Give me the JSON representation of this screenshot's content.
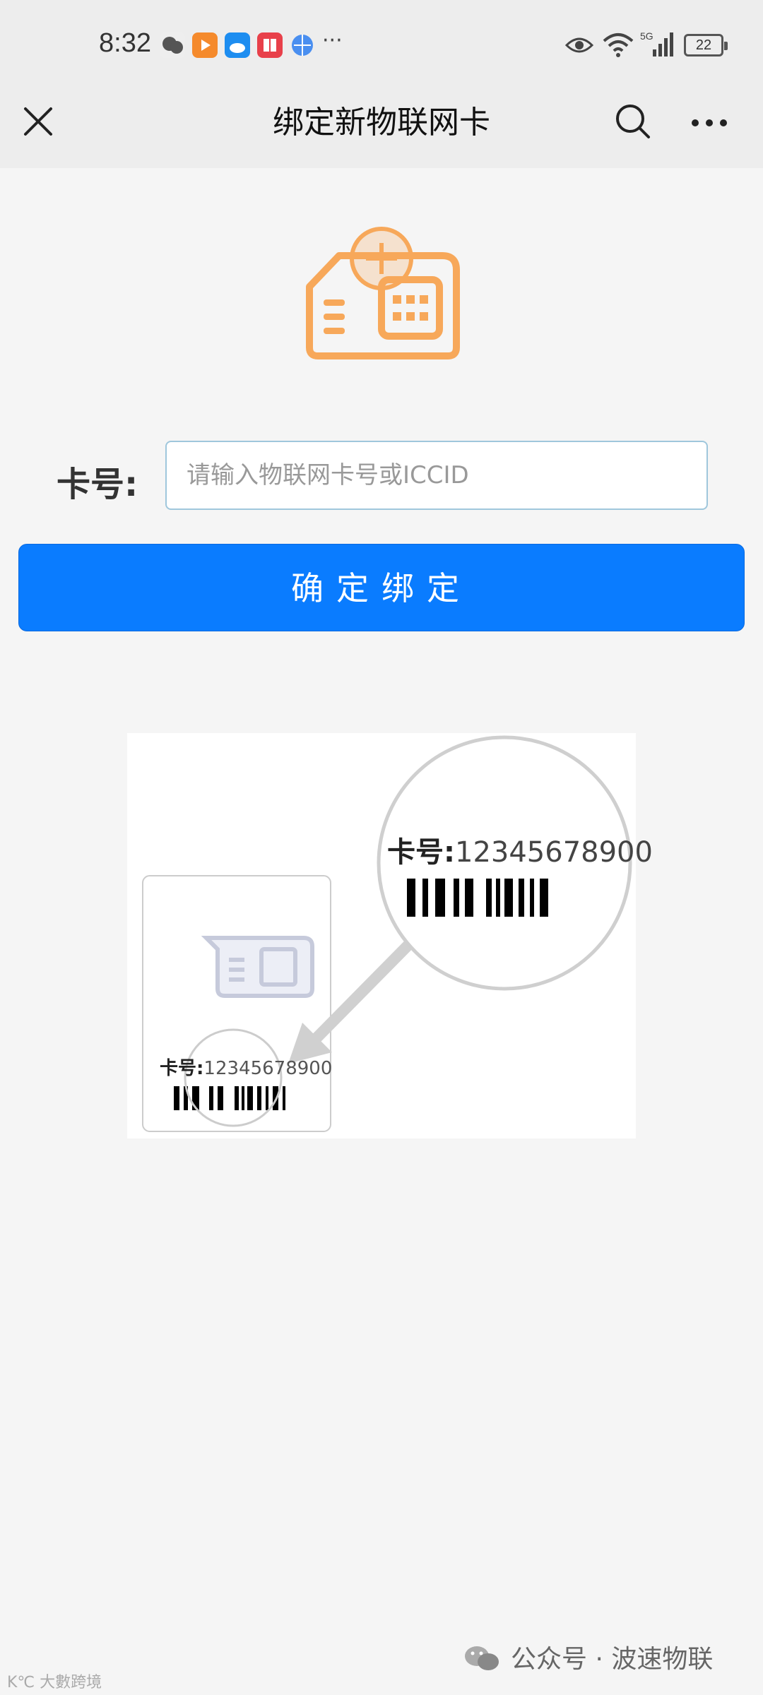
{
  "status_bar": {
    "time": "8:32",
    "more": "···",
    "network": "5G",
    "battery": "22"
  },
  "header": {
    "title": "绑定新物联网卡"
  },
  "form": {
    "card_label": "卡号:",
    "card_placeholder": "请输入物联网卡号或ICCID",
    "card_value": "",
    "confirm_label": "确定绑定"
  },
  "illustration": {
    "magnified_label": "卡号:",
    "magnified_number": "12345678900",
    "card_label": "卡号:",
    "card_number": "12345678900"
  },
  "footer": {
    "source": "公众号 · 波速物联",
    "watermark": "K℃ 大數跨境"
  },
  "colors": {
    "accent": "#0a7cff",
    "sim_orange": "#f7a85a",
    "header_bg": "#ededed",
    "page_bg": "#f5f5f5"
  },
  "icons": [
    "close-icon",
    "search-icon",
    "more-icon",
    "sim-card-add-icon",
    "barcode-icon",
    "wechat-icon"
  ]
}
